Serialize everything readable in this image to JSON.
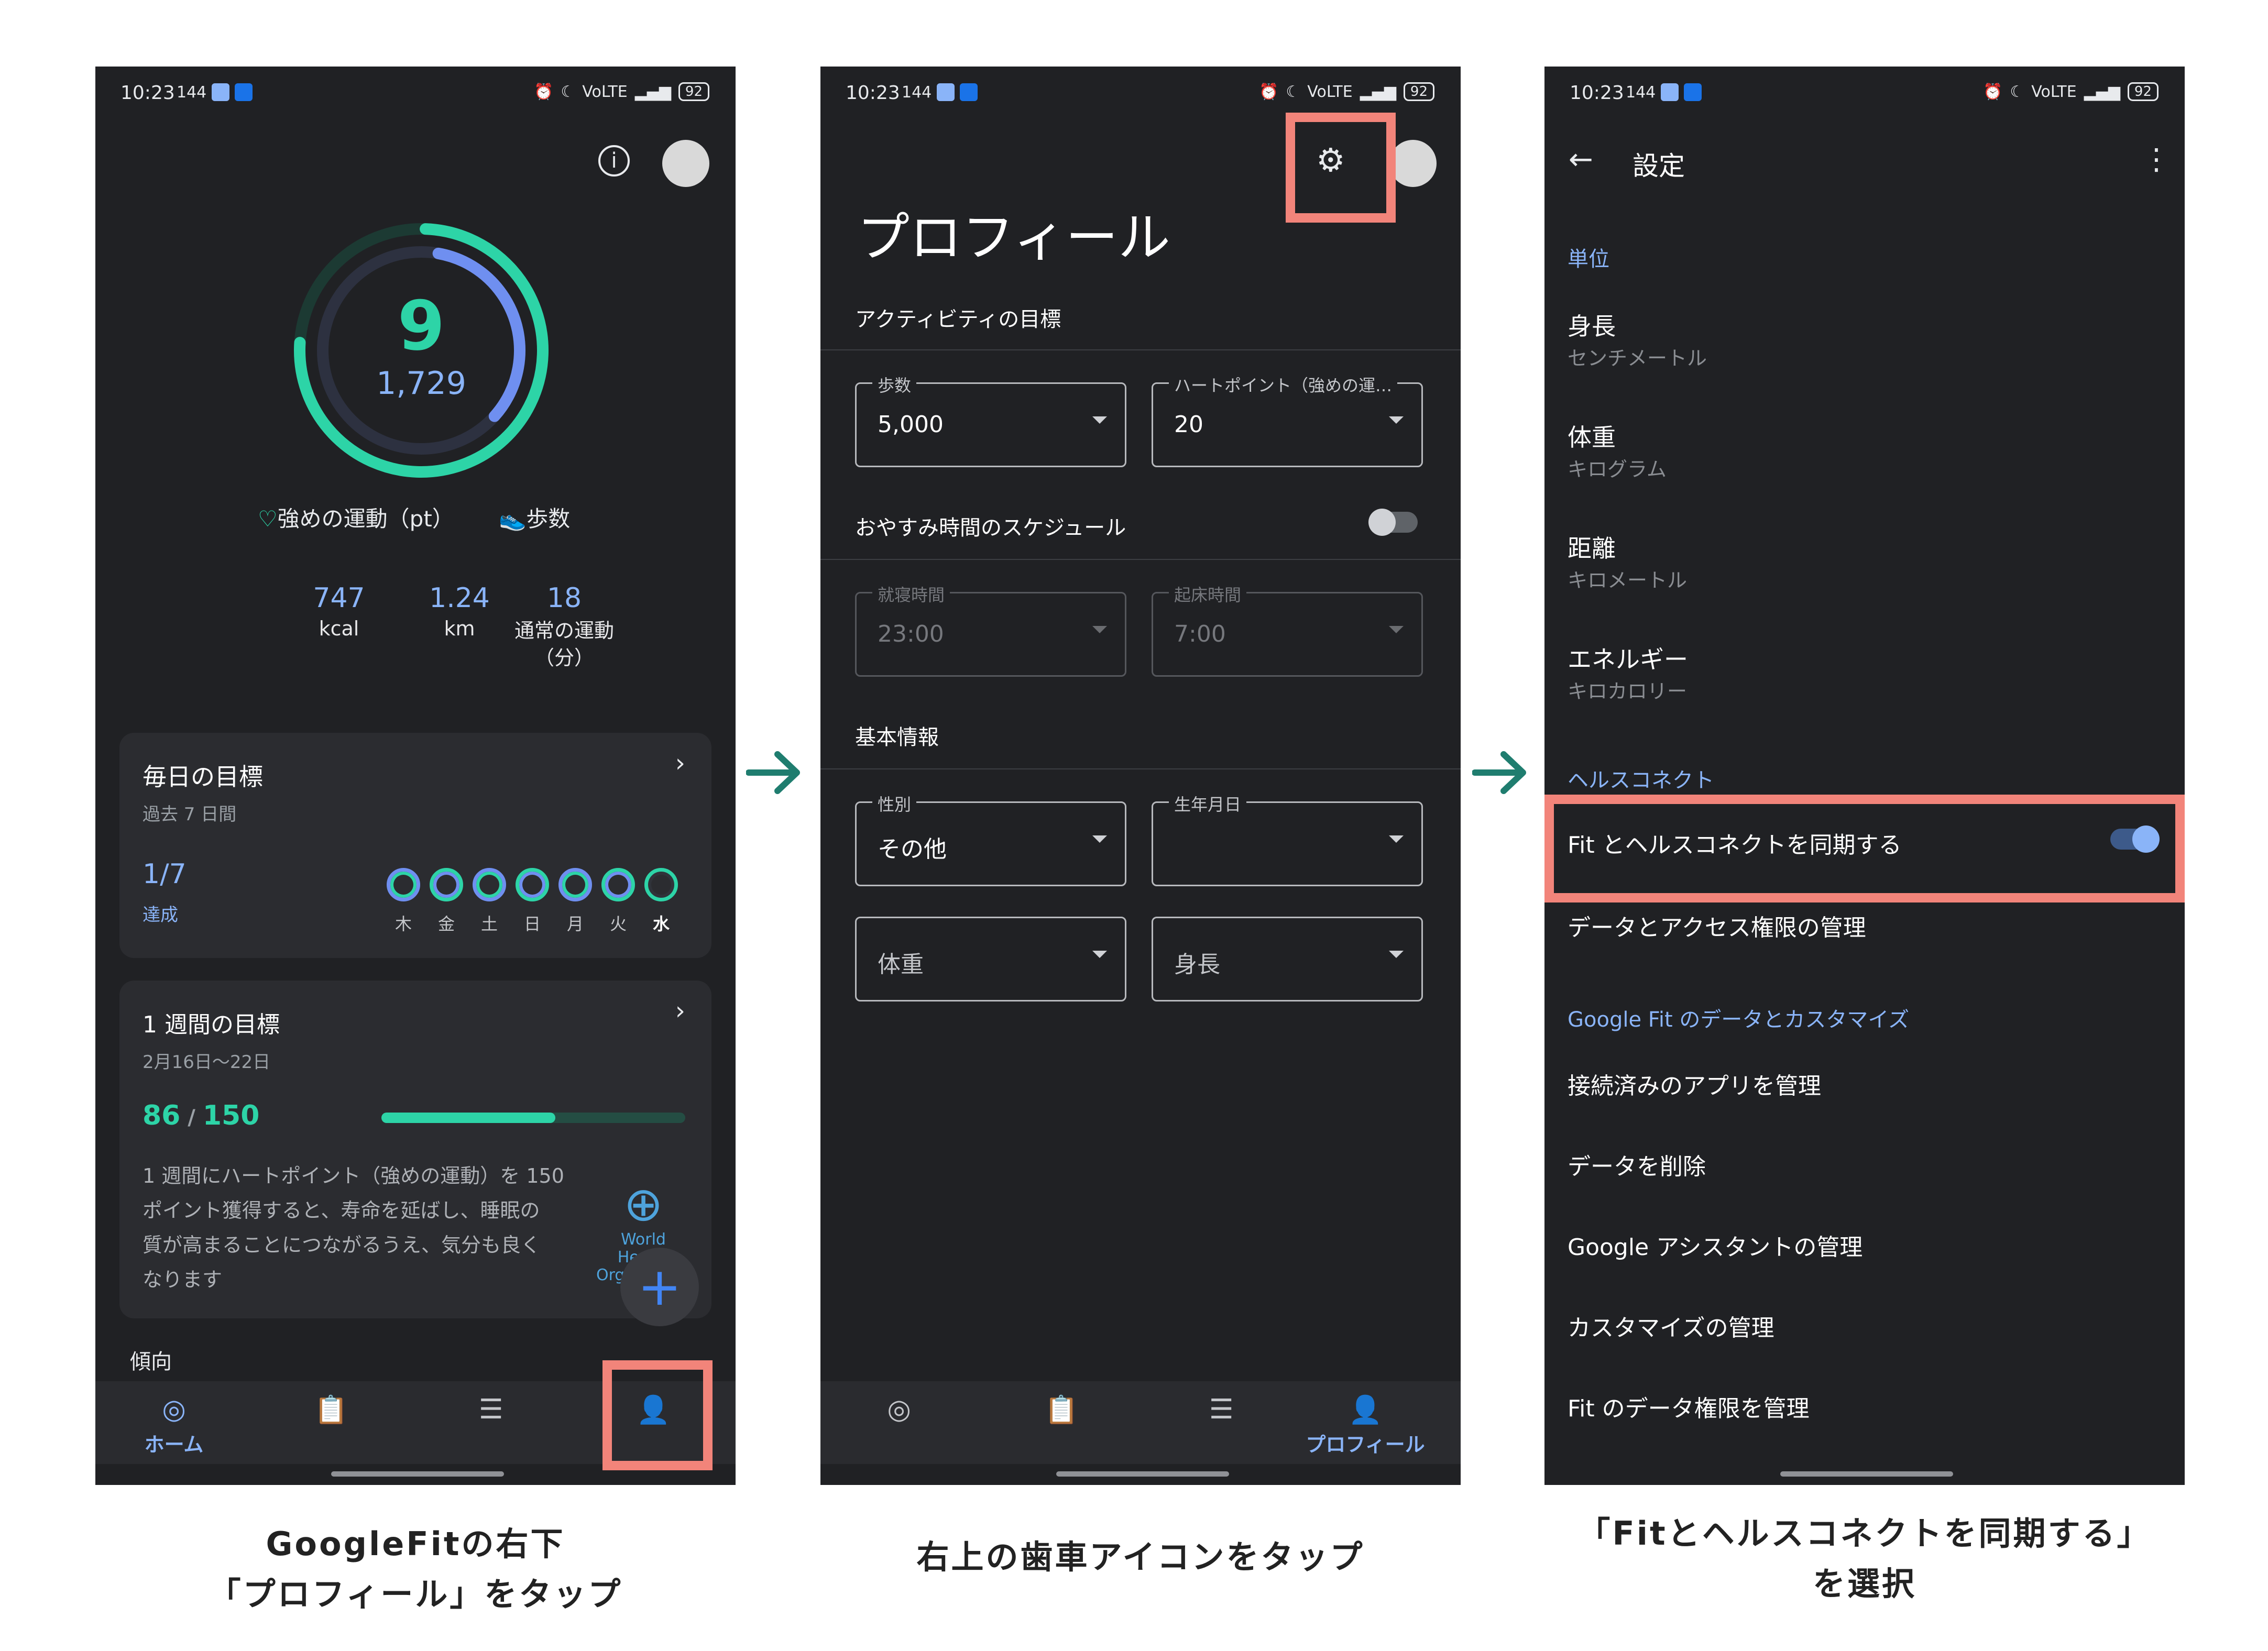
{
  "status": {
    "time": "10:23",
    "rate": "144",
    "network": "VoLTE",
    "battery": "92"
  },
  "screen1": {
    "ring_value": "9",
    "ring_sub": "1,729",
    "legend_heart": "強めの運動（pt）",
    "legend_steps": "歩数",
    "stats": [
      {
        "value": "747",
        "unit": "kcal"
      },
      {
        "value": "1.24",
        "unit": "km"
      },
      {
        "value": "18",
        "unit": "通常の運動\n（分）"
      }
    ],
    "daily": {
      "title": "毎日の目標",
      "subtitle": "過去 7 日間",
      "achieved": "1/7",
      "achieved_label": "達成",
      "days": [
        "木",
        "金",
        "土",
        "日",
        "月",
        "火",
        "水"
      ]
    },
    "weekly": {
      "title": "1 週間の目標",
      "range": "2月16日〜22日",
      "progress_value": "86",
      "progress_total": "150",
      "progress_fraction": 0.573,
      "desc_lines": [
        "1 週間にハートポイント（強めの運動）を 150",
        "ポイント獲得すると、寿命を延ばし、睡眠の",
        "質が高まることにつながるうえ、気分も良く",
        "なります"
      ],
      "who_label": "World Health Organization"
    },
    "trend": "傾向",
    "nav": {
      "home": "ホーム"
    }
  },
  "screen2": {
    "title": "プロフィール",
    "activity_goal": "アクティビティの目標",
    "steps_label": "歩数",
    "steps_value": "5,000",
    "heart_label": "ハートポイント（強めの運…",
    "heart_value": "20",
    "sleep_schedule": "おやすみ時間のスケジュール",
    "bedtime_label": "就寝時間",
    "bedtime_value": "23:00",
    "wake_label": "起床時間",
    "wake_value": "7:00",
    "basic_info": "基本情報",
    "gender_label": "性別",
    "gender_value": "その他",
    "birthday_label": "生年月日",
    "birthday_value": "",
    "weight_label": "体重",
    "height_label": "身長",
    "nav": {
      "profile": "プロフィール"
    }
  },
  "screen3": {
    "title": "設定",
    "units_header": "単位",
    "units": [
      {
        "title": "身長",
        "sub": "センチメートル"
      },
      {
        "title": "体重",
        "sub": "キログラム"
      },
      {
        "title": "距離",
        "sub": "キロメートル"
      },
      {
        "title": "エネルギー",
        "sub": "キロカロリー"
      }
    ],
    "health_header": "ヘルスコネクト",
    "sync_label": "Fit とヘルスコネクトを同期する",
    "sync_on": true,
    "data_access": "データとアクセス権限の管理",
    "gfit_header": "Google Fit のデータとカスタマイズ",
    "items": [
      "接続済みのアプリを管理",
      "データを削除",
      "Google アシスタントの管理",
      "カスタマイズの管理",
      "Fit のデータ権限を管理"
    ]
  },
  "captions": {
    "c1_line1": "GoogleFitの右下",
    "c1_line2": "「プロフィール」をタップ",
    "c2": "右上の歯車アイコンをタップ",
    "c3_line1": "「Fitとヘルスコネクトを同期する」",
    "c3_line2": "を選択"
  },
  "colors": {
    "accent": "#f2847a",
    "teal": "#1f7d6f",
    "blue": "#8ab4f8",
    "green": "#2dd4a7"
  }
}
